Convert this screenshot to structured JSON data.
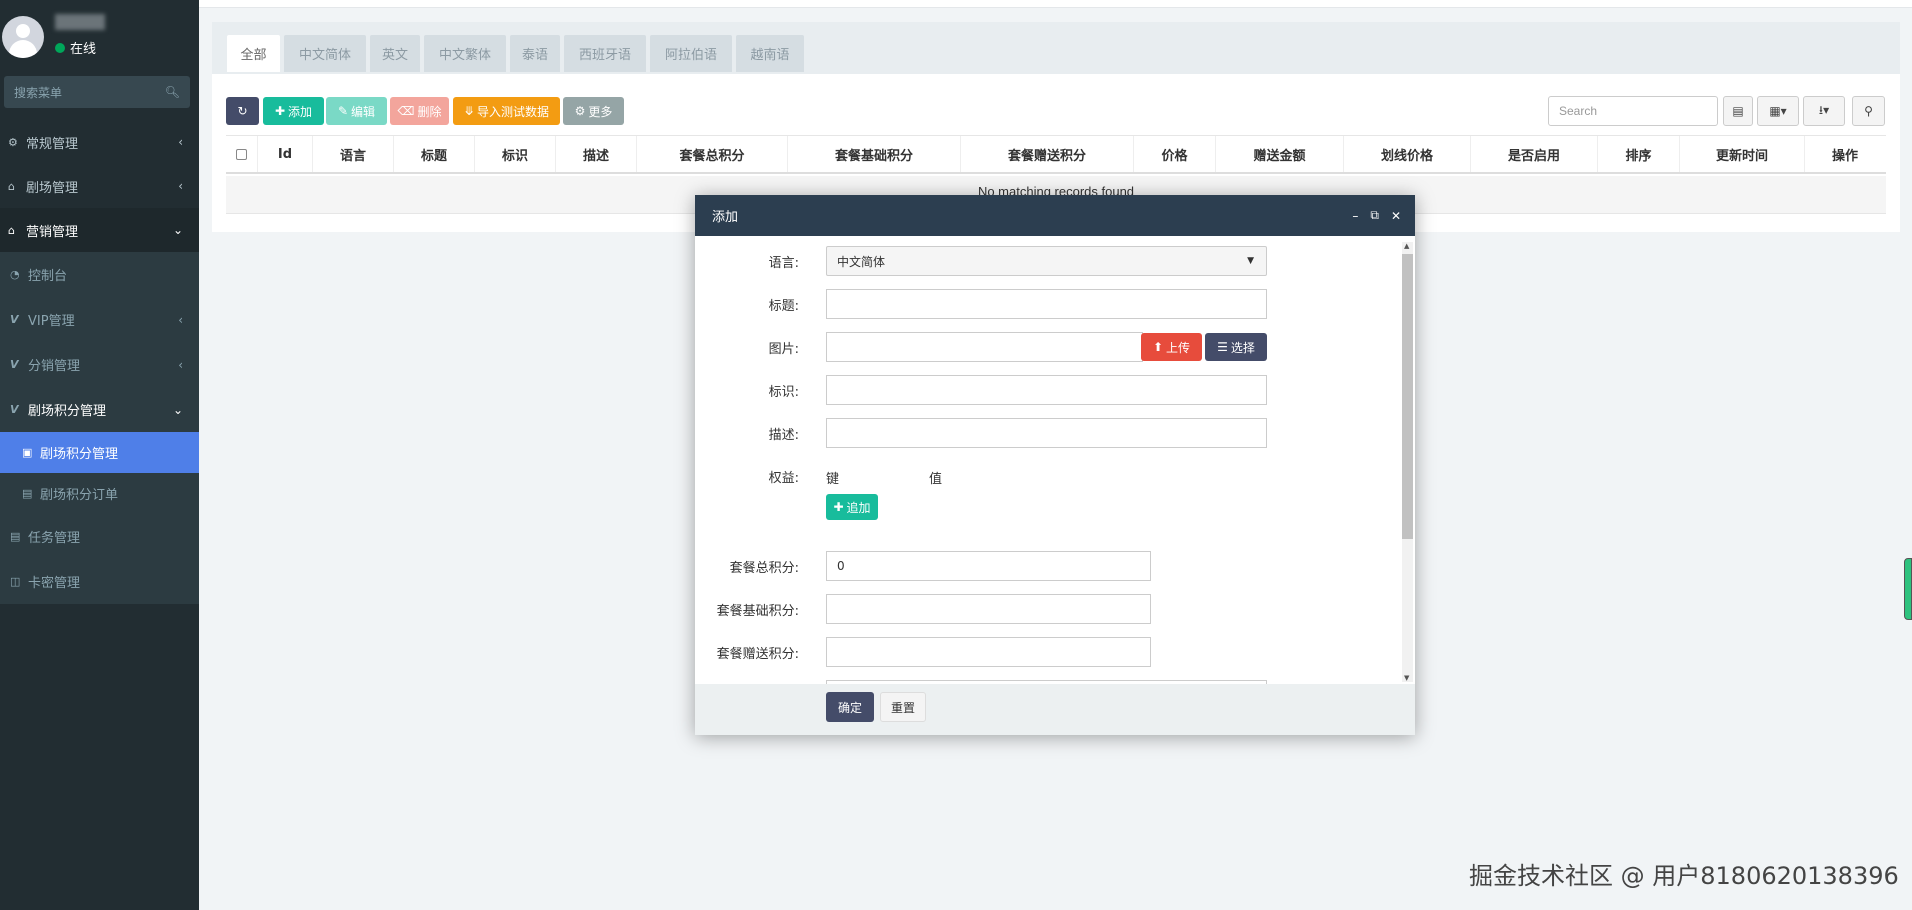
{
  "sidebar": {
    "user_name": "admin",
    "status": "在线",
    "search_placeholder": "搜索菜单",
    "items": [
      {
        "label": "常规管理",
        "icon": "cogs-icon"
      },
      {
        "label": "剧场管理",
        "icon": "home-icon"
      },
      {
        "label": "营销管理",
        "icon": "home-icon"
      },
      {
        "label": "控制台",
        "icon": "dashboard-icon"
      },
      {
        "label": "VIP管理",
        "icon": "vimeo-icon"
      },
      {
        "label": "分销管理",
        "icon": "vimeo-icon"
      },
      {
        "label": "剧场积分管理",
        "icon": "vimeo-icon"
      },
      {
        "label": "剧场积分管理",
        "icon": "vimeo-square-icon"
      },
      {
        "label": "剧场积分订单",
        "icon": "file-icon"
      },
      {
        "label": "任务管理",
        "icon": "file-icon"
      },
      {
        "label": "卡密管理",
        "icon": "money-icon"
      }
    ]
  },
  "tabs": [
    "全部",
    "中文简体",
    "英文",
    "中文繁体",
    "泰语",
    "西班牙语",
    "阿拉伯语",
    "越南语"
  ],
  "toolbar": {
    "add": "添加",
    "edit": "编辑",
    "delete": "删除",
    "import": "导入测试数据",
    "more": "更多",
    "search_placeholder": "Search"
  },
  "table": {
    "columns": [
      "Id",
      "语言",
      "标题",
      "标识",
      "描述",
      "套餐总积分",
      "套餐基础积分",
      "套餐赠送积分",
      "价格",
      "赠送金额",
      "划线价格",
      "是否启用",
      "排序",
      "更新时间",
      "操作"
    ],
    "empty_text": "No matching records found"
  },
  "modal": {
    "title": "添加",
    "fields": {
      "language_label": "语言:",
      "language_value": "中文简体",
      "title_label": "标题:",
      "image_label": "图片:",
      "upload": "上传",
      "choose": "选择",
      "mark_label": "标识:",
      "desc_label": "描述:",
      "rights_label": "权益:",
      "key": "键",
      "value": "值",
      "append": "追加",
      "total_points_label": "套餐总积分:",
      "total_points_value": "0",
      "base_points_label": "套餐基础积分:",
      "gift_points_label": "套餐赠送积分:"
    },
    "ok": "确定",
    "reset": "重置"
  },
  "watermark": "掘金技术社区 @ 用户8180620138396",
  "colors": {
    "sidebar_bg": "#222d32",
    "active_menu": "#4f7fe8",
    "modal_header": "#2c3e50",
    "success": "#18bc9c",
    "danger": "#e74c3c",
    "warning": "#f39c12"
  }
}
